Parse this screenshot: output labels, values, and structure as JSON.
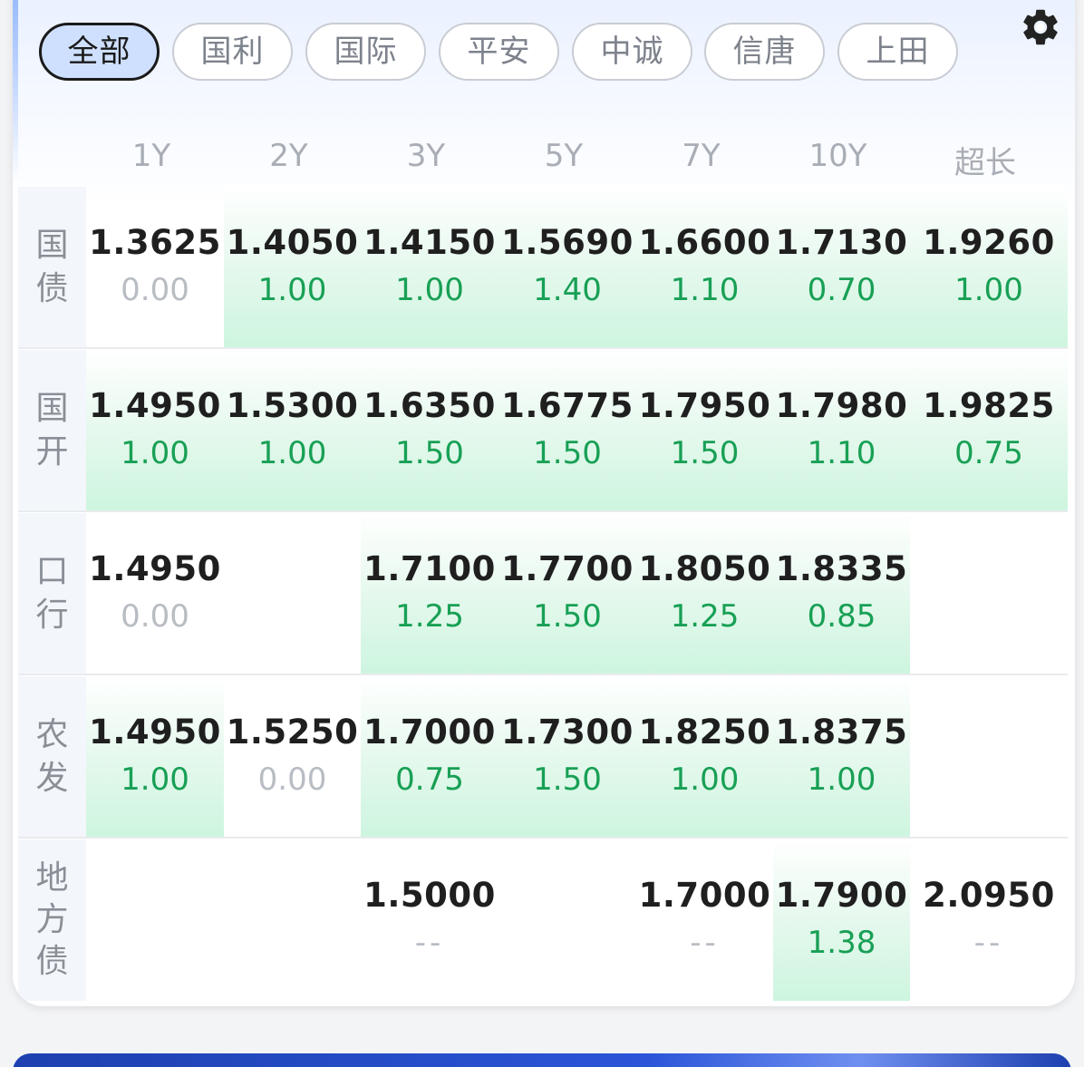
{
  "filters": {
    "tabs": [
      {
        "label": "全部",
        "active": true
      },
      {
        "label": "国利",
        "active": false
      },
      {
        "label": "国际",
        "active": false
      },
      {
        "label": "平安",
        "active": false
      },
      {
        "label": "中诚",
        "active": false
      },
      {
        "label": "信唐",
        "active": false
      },
      {
        "label": "上田",
        "active": false
      }
    ],
    "settings_icon": "gear-icon"
  },
  "table": {
    "columns": [
      "1Y",
      "2Y",
      "3Y",
      "5Y",
      "7Y",
      "10Y",
      "超长"
    ],
    "rows": [
      {
        "label": "国债",
        "cells": [
          {
            "rate": "1.3625",
            "change": "0.00",
            "highlight": false
          },
          {
            "rate": "1.4050",
            "change": "1.00",
            "highlight": true
          },
          {
            "rate": "1.4150",
            "change": "1.00",
            "highlight": true
          },
          {
            "rate": "1.5690",
            "change": "1.40",
            "highlight": true
          },
          {
            "rate": "1.6600",
            "change": "1.10",
            "highlight": true
          },
          {
            "rate": "1.7130",
            "change": "0.70",
            "highlight": true
          },
          {
            "rate": "1.9260",
            "change": "1.00",
            "highlight": true
          }
        ]
      },
      {
        "label": "国开",
        "cells": [
          {
            "rate": "1.4950",
            "change": "1.00",
            "highlight": true
          },
          {
            "rate": "1.5300",
            "change": "1.00",
            "highlight": true
          },
          {
            "rate": "1.6350",
            "change": "1.50",
            "highlight": true
          },
          {
            "rate": "1.6775",
            "change": "1.50",
            "highlight": true
          },
          {
            "rate": "1.7950",
            "change": "1.50",
            "highlight": true
          },
          {
            "rate": "1.7980",
            "change": "1.10",
            "highlight": true
          },
          {
            "rate": "1.9825",
            "change": "0.75",
            "highlight": true
          }
        ]
      },
      {
        "label": "口行",
        "cells": [
          {
            "rate": "1.4950",
            "change": "0.00",
            "highlight": false
          },
          {
            "rate": "",
            "change": "",
            "highlight": false
          },
          {
            "rate": "1.7100",
            "change": "1.25",
            "highlight": true
          },
          {
            "rate": "1.7700",
            "change": "1.50",
            "highlight": true
          },
          {
            "rate": "1.8050",
            "change": "1.25",
            "highlight": true
          },
          {
            "rate": "1.8335",
            "change": "0.85",
            "highlight": true
          },
          {
            "rate": "",
            "change": "",
            "highlight": false
          }
        ]
      },
      {
        "label": "农发",
        "cells": [
          {
            "rate": "1.4950",
            "change": "1.00",
            "highlight": true
          },
          {
            "rate": "1.5250",
            "change": "0.00",
            "highlight": false
          },
          {
            "rate": "1.7000",
            "change": "0.75",
            "highlight": true
          },
          {
            "rate": "1.7300",
            "change": "1.50",
            "highlight": true
          },
          {
            "rate": "1.8250",
            "change": "1.00",
            "highlight": true
          },
          {
            "rate": "1.8375",
            "change": "1.00",
            "highlight": true
          },
          {
            "rate": "",
            "change": "",
            "highlight": false
          }
        ]
      },
      {
        "label": "地方债",
        "cells": [
          {
            "rate": "",
            "change": "",
            "highlight": false
          },
          {
            "rate": "",
            "change": "",
            "highlight": false
          },
          {
            "rate": "1.5000",
            "change": "--",
            "highlight": false
          },
          {
            "rate": "",
            "change": "",
            "highlight": false
          },
          {
            "rate": "1.7000",
            "change": "--",
            "highlight": false
          },
          {
            "rate": "1.7900",
            "change": "1.38",
            "highlight": true
          },
          {
            "rate": "2.0950",
            "change": "--",
            "highlight": false
          }
        ]
      }
    ]
  },
  "colors": {
    "positive_change": "#18a055",
    "zero_change": "#b8bcc3",
    "active_tab_bg": "#cfe0ff",
    "highlight_cell": "#cdf5df"
  }
}
